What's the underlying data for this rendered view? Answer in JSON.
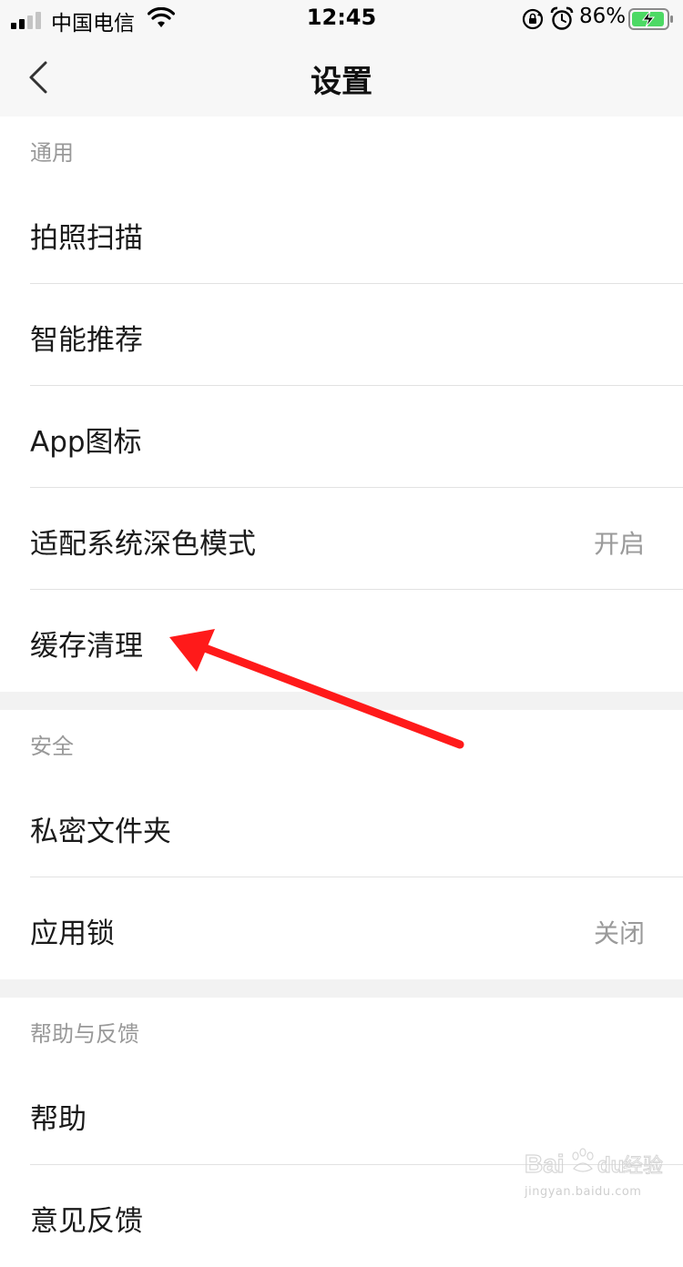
{
  "status_bar": {
    "carrier": "中国电信",
    "time": "12:45",
    "battery_percent": "86%",
    "icons": [
      "signal-icon",
      "wifi-icon",
      "rotation-lock-icon",
      "alarm-icon",
      "battery-charging-icon"
    ]
  },
  "nav": {
    "title": "设置",
    "back_icon": "chevron-left-icon"
  },
  "sections": [
    {
      "header": "通用",
      "rows": [
        {
          "label": "拍照扫描",
          "value": ""
        },
        {
          "label": "智能推荐",
          "value": ""
        },
        {
          "label": "App图标",
          "value": ""
        },
        {
          "label": "适配系统深色模式",
          "value": "开启"
        },
        {
          "label": "缓存清理",
          "value": ""
        }
      ]
    },
    {
      "header": "安全",
      "rows": [
        {
          "label": "私密文件夹",
          "value": ""
        },
        {
          "label": "应用锁",
          "value": "关闭"
        }
      ]
    },
    {
      "header": "帮助与反馈",
      "rows": [
        {
          "label": "帮助",
          "value": ""
        },
        {
          "label": "意见反馈",
          "value": ""
        }
      ]
    }
  ],
  "annotation": {
    "color": "#ff1a1a",
    "points_to": "缓存清理"
  },
  "watermark": {
    "brand": "Baidu经验",
    "url": "jingyan.baidu.com"
  }
}
